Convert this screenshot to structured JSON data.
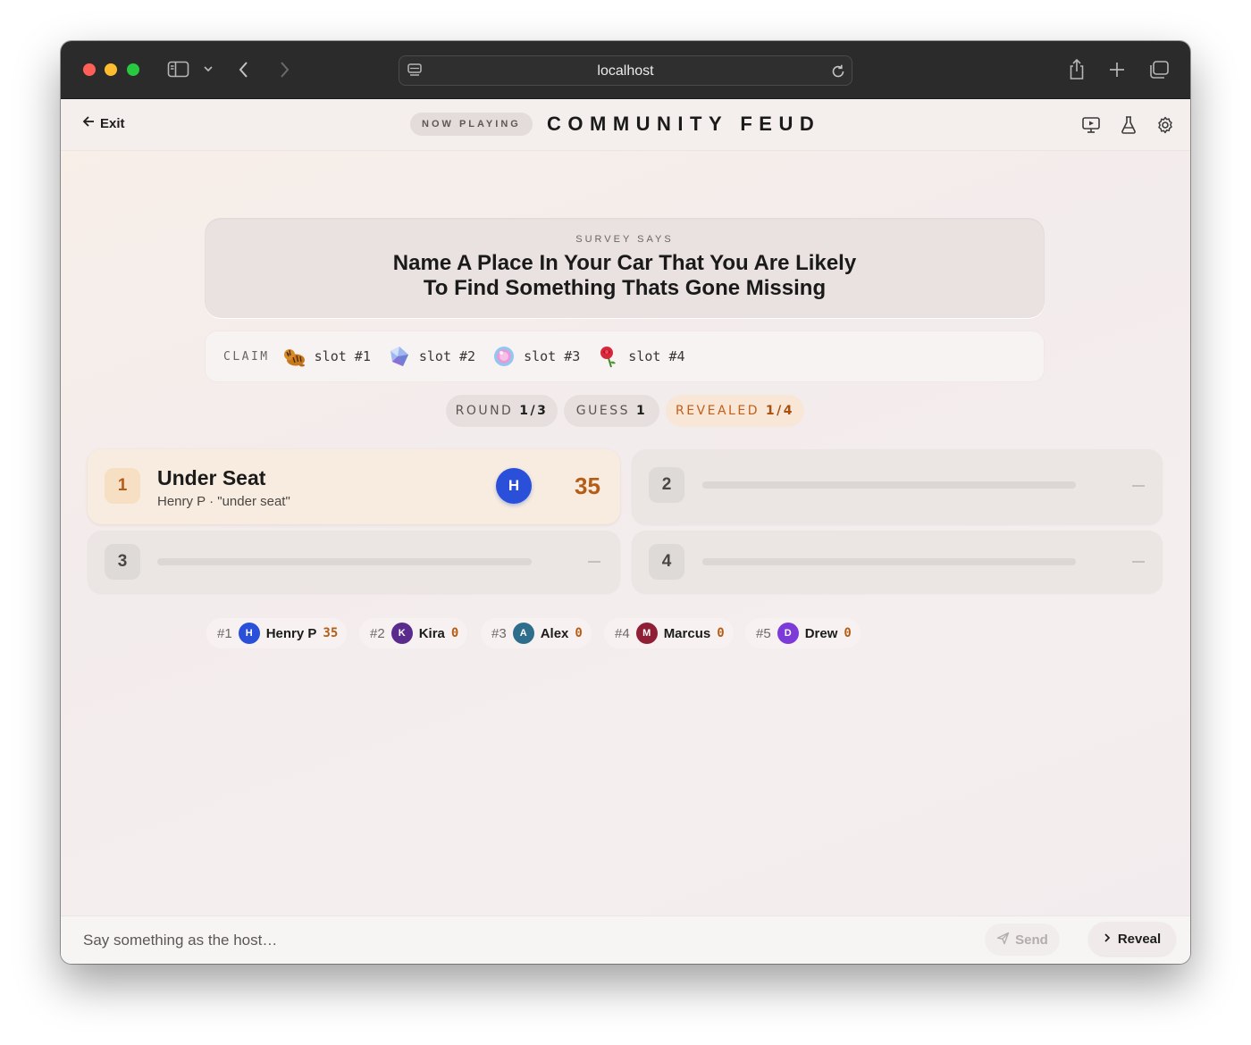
{
  "browser": {
    "url": "localhost"
  },
  "header": {
    "exit_label": "Exit",
    "now_playing": "NOW PLAYING",
    "title": "COMMUNITY FEUD"
  },
  "survey": {
    "label": "SURVEY SAYS",
    "question_line1": "Name A Place In Your Car That You Are Likely",
    "question_line2": "To Find Something Thats Gone Missing"
  },
  "claim": {
    "label": "CLAIM",
    "slots": [
      {
        "label": "slot #1",
        "icon": "tiger-emoji"
      },
      {
        "label": "slot #2",
        "icon": "crystal-emoji"
      },
      {
        "label": "slot #3",
        "icon": "candy-emoji"
      },
      {
        "label": "slot #4",
        "icon": "rose-emoji"
      }
    ]
  },
  "status": {
    "round_label": "ROUND",
    "round_value": "1/3",
    "guess_label": "GUESS",
    "guess_value": "1",
    "revealed_label": "REVEALED",
    "revealed_value": "1/4"
  },
  "answers": [
    {
      "number": "1",
      "revealed": true,
      "text": "Under Seat",
      "player": "Henry P",
      "guess": "\"under seat\"",
      "avatar": "H",
      "points": "35"
    },
    {
      "number": "2",
      "revealed": false
    },
    {
      "number": "3",
      "revealed": false
    },
    {
      "number": "4",
      "revealed": false
    }
  ],
  "scoreboard": [
    {
      "rank": "#1",
      "initial": "H",
      "name": "Henry P",
      "score": "35",
      "color": "#2a4fd8"
    },
    {
      "rank": "#2",
      "initial": "K",
      "name": "Kira",
      "score": "0",
      "color": "#5a2a8c"
    },
    {
      "rank": "#3",
      "initial": "A",
      "name": "Alex",
      "score": "0",
      "color": "#2e6e8c"
    },
    {
      "rank": "#4",
      "initial": "M",
      "name": "Marcus",
      "score": "0",
      "color": "#8f1f35"
    },
    {
      "rank": "#5",
      "initial": "D",
      "name": "Drew",
      "score": "0",
      "color": "#7c3ad8"
    }
  ],
  "composer": {
    "placeholder": "Say something as the host…",
    "send_label": "Send",
    "reveal_label": "Reveal"
  },
  "colors": {
    "accent": "#b55d16",
    "revealed_card": "#f7ecdf"
  }
}
